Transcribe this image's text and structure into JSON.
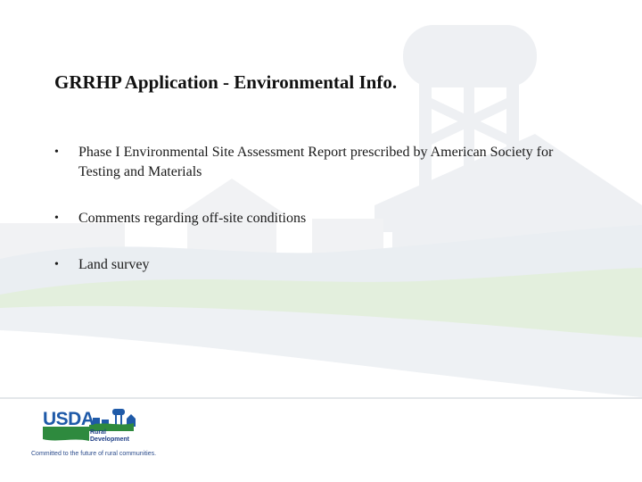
{
  "slide": {
    "title": "GRRHP Application - Environmental Info.",
    "bullets": [
      {
        "marker": "•",
        "text": "Phase I Environmental Site Assessment Report prescribed by American Society for Testing and Materials"
      },
      {
        "marker": "•",
        "text": "Comments regarding off-site conditions"
      },
      {
        "marker": "•",
        "text": "Land survey"
      }
    ]
  },
  "footer": {
    "logo_text": "USDA",
    "agency_line1": "Rural",
    "agency_line2": "Development",
    "tagline": "Committed to the future of rural communities."
  },
  "colors": {
    "background": "#ffffff",
    "watermark": "#eef0f3",
    "green_band": "#e3efdd",
    "usda_blue": "#1f5aa8",
    "usda_green": "#2e8a3e"
  }
}
